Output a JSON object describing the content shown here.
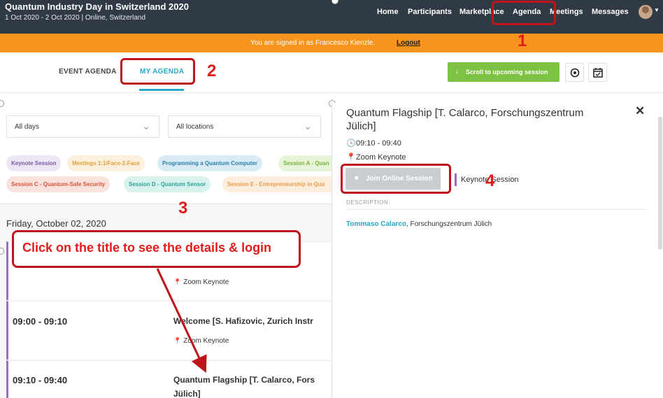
{
  "header": {
    "event_title": "Quantum Industry Day in Switzerland 2020",
    "event_subtitle": "1 Oct 2020 - 2 Oct 2020 | Online, Switzerland",
    "nav": [
      "Home",
      "Participants",
      "Marketplace",
      "Agenda",
      "Meetings",
      "Messages"
    ]
  },
  "signin_banner": {
    "text": "You are signed in as Francesco Kienzle.",
    "logout": "Logout"
  },
  "tabs": {
    "event_agenda": "EVENT AGENDA",
    "my_agenda": "MY AGENDA",
    "scroll_button": "Scroll to upcoming session"
  },
  "filters": {
    "days": "All days",
    "locations": "All locations",
    "tags": [
      "Keynote Session",
      "Meetings 1:1/Face-2-Face",
      "Programming a Quantum Computer",
      "Session A - Quan",
      "Session C - Quantum-Safe Security",
      "Session D - Quantum Sensor",
      "Session E - Entrepreneurship in Qua"
    ],
    "tag_colors": {
      "keynote": "#ede6f5",
      "meetings": "#fdf0dc",
      "programming": "#d9ecf6",
      "session_a": "#e8f4d8",
      "session_c": "#fbe3dd",
      "session_d": "#d8f2ee",
      "session_e": "#fdeede"
    }
  },
  "agenda": {
    "day": "Friday, October 02, 2020",
    "sessions": [
      {
        "time": "",
        "title": "",
        "location": "Zoom Keynote"
      },
      {
        "time": "09:00 - 09:10",
        "title": "Welcome [S. Hafizovic, Zurich Instr",
        "location": "Zoom Keynote"
      },
      {
        "time": "09:10 - 09:40",
        "title": "Quantum Flagship [T. Calarco, Fors",
        "title_line2": "Jülich]",
        "location": ""
      }
    ]
  },
  "detail": {
    "title_line1": "Quantum Flagship [T. Calarco, Forschungszentrum",
    "title_line2": "Jülich]",
    "time": "09:10 - 09:40",
    "location": "Zoom Keynote",
    "join_button": "Join Online Session",
    "session_type": "Keynote Session",
    "description_label": "DESCRIPTION:",
    "speaker": "Tommaso Calarco",
    "affiliation": ", Forschungszentrum Jülich"
  },
  "annotations": {
    "n1": "1",
    "n2": "2",
    "n3": "3",
    "n4": "4",
    "callout": "Click on the title to see the details & login"
  },
  "colors": {
    "header": "#2f3a45",
    "banner": "#f7941d",
    "accent": "#29a8c9",
    "green_button": "#7dc243",
    "annotation_red": "#c0141b",
    "keynote_purple": "#9b6fc0"
  }
}
